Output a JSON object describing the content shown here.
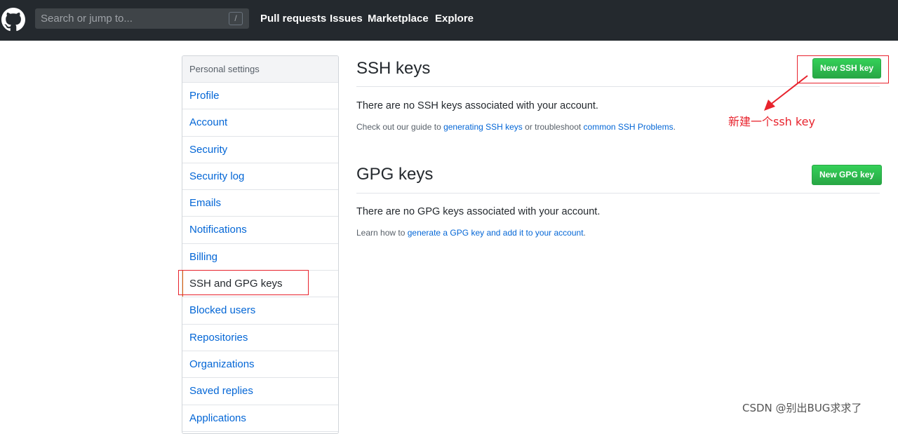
{
  "header": {
    "search_placeholder": "Search or jump to...",
    "search_shortcut": "/",
    "nav": [
      "Pull requests",
      "Issues",
      "Marketplace",
      "Explore"
    ]
  },
  "sidebar": {
    "heading": "Personal settings",
    "items": [
      "Profile",
      "Account",
      "Security",
      "Security log",
      "Emails",
      "Notifications",
      "Billing",
      "SSH and GPG keys",
      "Blocked users",
      "Repositories",
      "Organizations",
      "Saved replies",
      "Applications"
    ],
    "active_index": 7
  },
  "ssh": {
    "title": "SSH keys",
    "button": "New SSH key",
    "message": "There are no SSH keys associated with your account.",
    "note_prefix": "Check out our guide to ",
    "note_link1": "generating SSH keys",
    "note_middle": " or troubleshoot ",
    "note_link2": "common SSH Problems",
    "note_suffix": "."
  },
  "gpg": {
    "title": "GPG keys",
    "button": "New GPG key",
    "message": "There are no GPG keys associated with your account.",
    "note_prefix": "Learn how to ",
    "note_link": "generate a GPG key and add it to your account",
    "note_suffix": "."
  },
  "annotation": {
    "text": "新建一个ssh key",
    "color": "#e8232d"
  },
  "watermark": "CSDN @别出BUG求求了",
  "colors": {
    "header_bg": "#24292e",
    "link": "#0366d6",
    "button_green": "#2cbe4e"
  }
}
